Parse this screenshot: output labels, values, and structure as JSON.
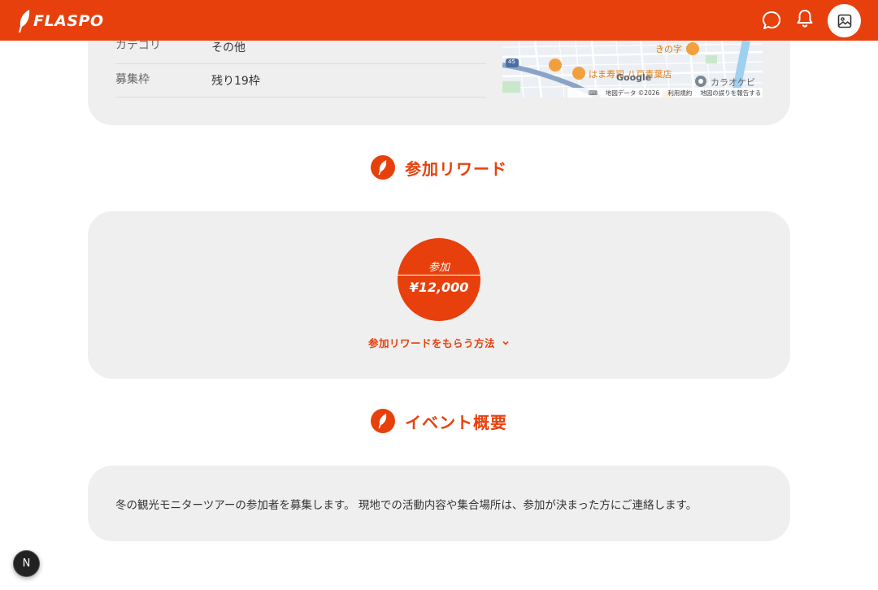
{
  "header": {
    "logo_text": "FLASPO",
    "brand_color": "#e8400c",
    "icons": [
      "chat-icon",
      "bell-icon",
      "image-icon"
    ]
  },
  "info": {
    "rows": [
      {
        "label": "カテゴリ",
        "value": "その他"
      },
      {
        "label": "募集枠",
        "value": "残り19枠"
      }
    ],
    "map": {
      "labels": [
        "きの字",
        "はま寿司 八戸青葉店",
        "カラオケビ",
        "45"
      ],
      "google": "Google",
      "keyboard": "⌨",
      "footer_data": "地図データ ©2026",
      "footer_terms": "利用規約",
      "footer_report": "地図の誤りを報告する"
    }
  },
  "reward_section": {
    "title": "参加リワード",
    "caption": "参加",
    "amount": "¥12,000",
    "howto_label": "参加リワードをもらう方法"
  },
  "overview_section": {
    "title": "イベント概要",
    "description": "冬の観光モニターツアーの参加者を募集します。 現地での活動内容や集合場所は、参加が決まった方にご連絡します。"
  },
  "floating_badge": "N"
}
